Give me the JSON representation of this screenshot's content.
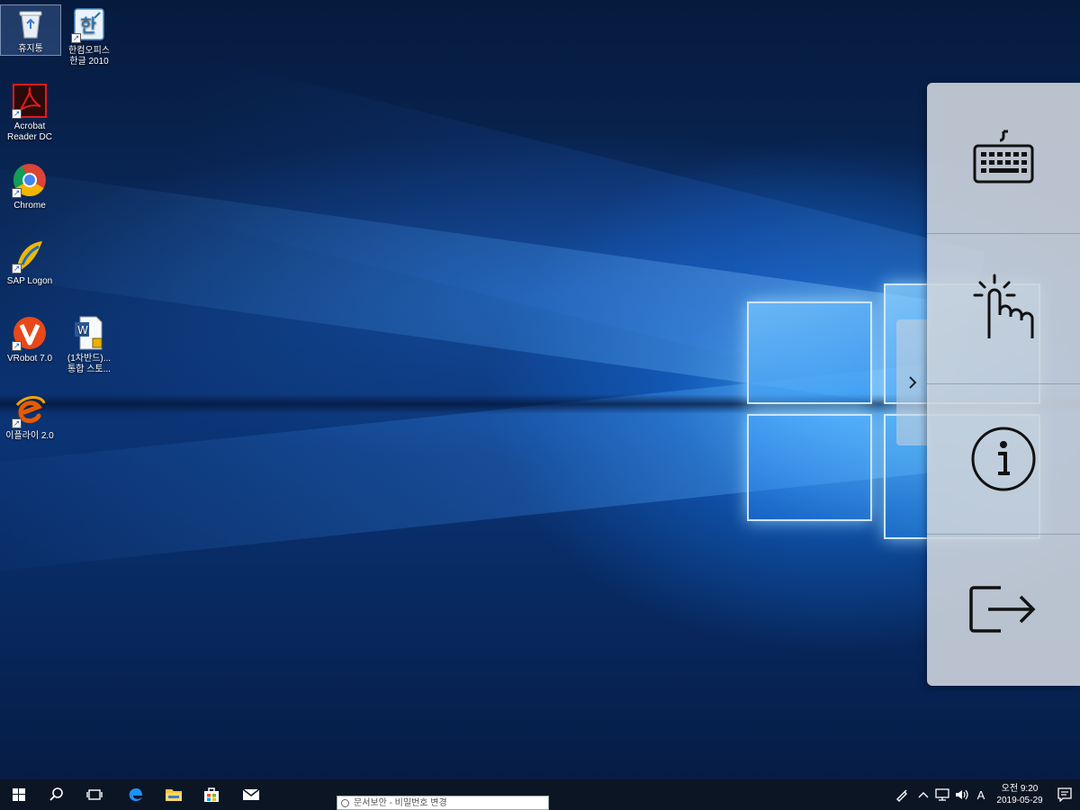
{
  "desktop": {
    "icons": [
      {
        "id": "recycle",
        "label": "휴지통"
      },
      {
        "id": "hancom",
        "label": "한컴오피스\n한글 2010"
      },
      {
        "id": "acrobat",
        "label": "Acrobat\nReader DC"
      },
      {
        "id": "chrome",
        "label": "Chrome"
      },
      {
        "id": "sap",
        "label": "SAP Logon"
      },
      {
        "id": "vrobot",
        "label": "VRobot 7.0"
      },
      {
        "id": "word-doc",
        "label": "(1차반드)...\n통합 스토..."
      },
      {
        "id": "ecollab",
        "label": "이플라이 2.0"
      }
    ]
  },
  "side_panel": {
    "buttons": [
      {
        "name": "keyboard",
        "icon": "keyboard-icon"
      },
      {
        "name": "touch",
        "icon": "touch-hand-icon"
      },
      {
        "name": "info",
        "icon": "info-icon"
      },
      {
        "name": "exit",
        "icon": "exit-icon"
      }
    ],
    "collapse_icon": "chevron-right-icon",
    "background": "#cdd4dc"
  },
  "taskbar": {
    "search_text": "문서보안 - 비밀번호 변경",
    "tray": {
      "ime": "A",
      "time": "오전 9:20",
      "date": "2019-05-29"
    }
  }
}
